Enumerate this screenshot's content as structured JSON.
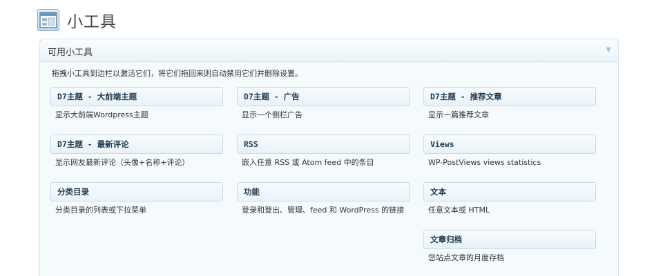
{
  "page": {
    "title": "小工具"
  },
  "panel": {
    "title": "可用小工具",
    "toggle_icon": "▼",
    "description": "拖拽小工具到边栏以激活它们，将它们拖回来则自动禁用它们并删除设置。"
  },
  "widgets": [
    {
      "title": "D7主题 - 大前端主题",
      "desc": "显示大前端Wordpress主题"
    },
    {
      "title": "D7主题 - 广告",
      "desc": "显示一个侧栏广告"
    },
    {
      "title": "D7主题 - 推荐文章",
      "desc": "显示一篇推荐文章"
    },
    {
      "title": "D7主题 - 最新评论",
      "desc": "显示网友最新评论（头像+名称+评论）"
    },
    {
      "title": "RSS",
      "desc": "嵌入任意 RSS 或 Atom feed 中的条目"
    },
    {
      "title": "Views",
      "desc": "WP-PostViews views statistics"
    },
    {
      "title": "分类目录",
      "desc": "分类目录的列表或下拉菜单"
    },
    {
      "title": "功能",
      "desc": "登录和登出、管理、feed 和 WordPress 的链接"
    },
    {
      "title": "文本",
      "desc": "任意文本或 HTML"
    },
    {
      "title": "文章归档",
      "desc": "您站点文章的月度存档"
    }
  ]
}
